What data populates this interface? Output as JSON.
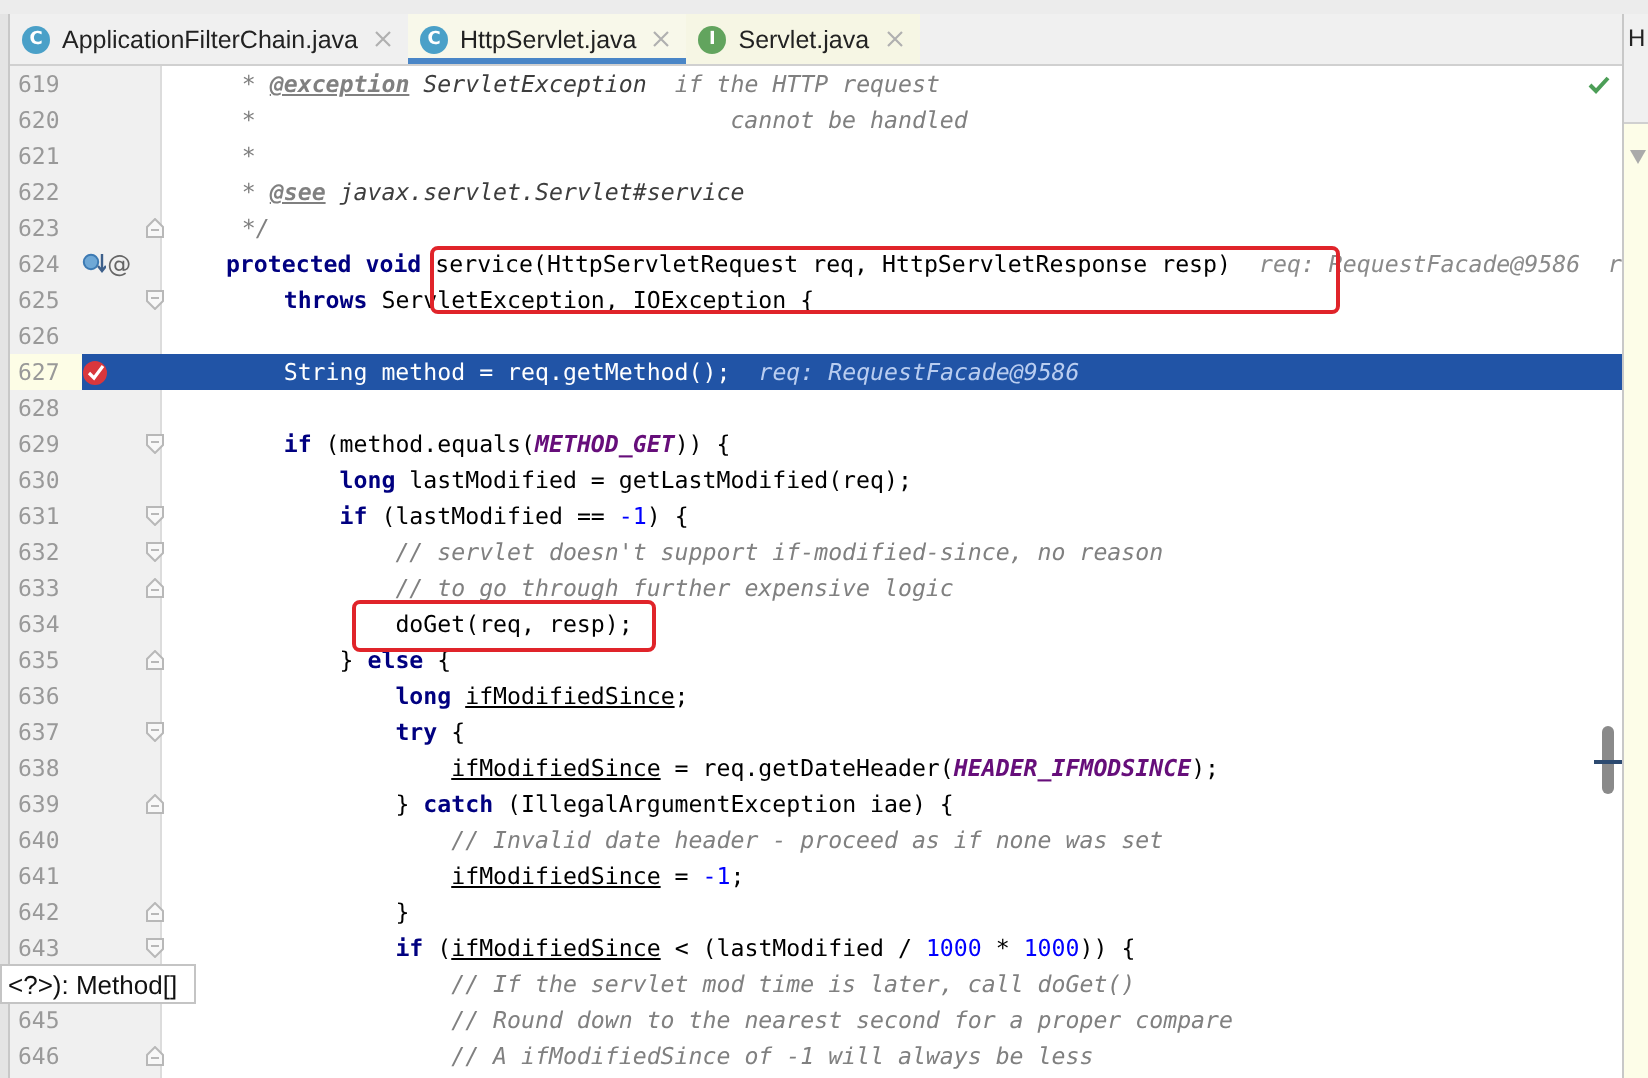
{
  "tabs": [
    {
      "label": "ApplicationFilterChain.java",
      "badge": "C",
      "selected": false,
      "library": false
    },
    {
      "label": "HttpServlet.java",
      "badge": "C",
      "selected": true,
      "library": true
    },
    {
      "label": "Servlet.java",
      "badge": "I",
      "selected": false,
      "library": true
    }
  ],
  "side_panel": {
    "title": "H"
  },
  "lines": [
    {
      "number": "619",
      "tokens": [
        {
          "text": "     * ",
          "kind": "comment"
        },
        {
          "text": "@exception",
          "kind": "doctag"
        },
        {
          "text": " ServletException",
          "kind": "docref"
        },
        {
          "text": "  if the HTTP request",
          "kind": "comment"
        }
      ]
    },
    {
      "number": "620",
      "tokens": [
        {
          "text": "     *                                  cannot be handled",
          "kind": "comment"
        }
      ]
    },
    {
      "number": "621",
      "tokens": [
        {
          "text": "     *",
          "kind": "comment"
        }
      ]
    },
    {
      "number": "622",
      "tokens": [
        {
          "text": "     * ",
          "kind": "comment"
        },
        {
          "text": "@see",
          "kind": "doctag"
        },
        {
          "text": " javax.servlet.Servlet#service",
          "kind": "docref"
        }
      ]
    },
    {
      "number": "623",
      "fold": {
        "kind": "end"
      },
      "tokens": [
        {
          "text": "     */",
          "kind": "comment"
        }
      ]
    },
    {
      "number": "624",
      "marker": {
        "kind": "overriding",
        "symbol": "@"
      },
      "tokens": [
        {
          "text": "    protected void ",
          "kind": "kw"
        },
        {
          "text": "service(HttpServletRequest req, HttpServletResponse resp)",
          "kind": "plain"
        }
      ],
      "hint": "req: RequestFacade@9586  r"
    },
    {
      "number": "625",
      "fold": {
        "kind": "start"
      },
      "tokens": [
        {
          "text": "        throws ",
          "kind": "kw"
        },
        {
          "text": "ServletException, IOException {",
          "kind": "plain"
        }
      ]
    },
    {
      "number": "626"
    },
    {
      "number": "627",
      "selected": true,
      "marker": {
        "kind": "breakpoint"
      },
      "tokens": [
        {
          "text": "        String method = req.getMethod();",
          "kind": "plain"
        }
      ],
      "hint": "req: RequestFacade@9586"
    },
    {
      "number": "628"
    },
    {
      "number": "629",
      "fold": {
        "kind": "start"
      },
      "tokens": [
        {
          "text": "        if ",
          "kind": "kw"
        },
        {
          "text": "(method.equals(",
          "kind": "plain"
        },
        {
          "text": "METHOD_GET",
          "kind": "const"
        },
        {
          "text": ")) {",
          "kind": "plain"
        }
      ]
    },
    {
      "number": "630",
      "tokens": [
        {
          "text": "            long ",
          "kind": "kw"
        },
        {
          "text": "lastModified = getLastModified(req);",
          "kind": "plain"
        }
      ]
    },
    {
      "number": "631",
      "fold": {
        "kind": "start"
      },
      "tokens": [
        {
          "text": "            if ",
          "kind": "kw"
        },
        {
          "text": "(lastModified == ",
          "kind": "plain"
        },
        {
          "text": "-1",
          "kind": "num"
        },
        {
          "text": ") {",
          "kind": "plain"
        }
      ]
    },
    {
      "number": "632",
      "fold": {
        "kind": "start"
      },
      "tokens": [
        {
          "text": "                // servlet doesn't support if-modified-since, no reason",
          "kind": "comment"
        }
      ]
    },
    {
      "number": "633",
      "fold": {
        "kind": "end"
      },
      "tokens": [
        {
          "text": "                // to go through further expensive logic",
          "kind": "comment"
        }
      ]
    },
    {
      "number": "634",
      "tokens": [
        {
          "text": "                doGet(req, resp);",
          "kind": "plain"
        }
      ]
    },
    {
      "number": "635",
      "fold": {
        "kind": "end"
      },
      "tokens": [
        {
          "text": "            } ",
          "kind": "plain"
        },
        {
          "text": "else ",
          "kind": "kw"
        },
        {
          "text": "{",
          "kind": "plain"
        }
      ]
    },
    {
      "number": "636",
      "tokens": [
        {
          "text": "                long ",
          "kind": "kw"
        },
        {
          "text": "ifModifiedSince",
          "kind": "var"
        },
        {
          "text": ";",
          "kind": "plain"
        }
      ]
    },
    {
      "number": "637",
      "fold": {
        "kind": "start"
      },
      "tokens": [
        {
          "text": "                try ",
          "kind": "kw"
        },
        {
          "text": "{",
          "kind": "plain"
        }
      ]
    },
    {
      "number": "638",
      "tokens": [
        {
          "text": "                    ifModifiedSince",
          "kind": "var"
        },
        {
          "text": " = req.getDateHeader(",
          "kind": "plain"
        },
        {
          "text": "HEADER_IFMODSINCE",
          "kind": "const"
        },
        {
          "text": ");",
          "kind": "plain"
        }
      ]
    },
    {
      "number": "639",
      "fold": {
        "kind": "end"
      },
      "tokens": [
        {
          "text": "                } ",
          "kind": "plain"
        },
        {
          "text": "catch ",
          "kind": "kw"
        },
        {
          "text": "(IllegalArgumentException iae) {",
          "kind": "plain"
        }
      ]
    },
    {
      "number": "640",
      "tokens": [
        {
          "text": "                    // Invalid date header - proceed as if none was set",
          "kind": "comment"
        }
      ]
    },
    {
      "number": "641",
      "tokens": [
        {
          "text": "                    ifModifiedSince",
          "kind": "var"
        },
        {
          "text": " = ",
          "kind": "plain"
        },
        {
          "text": "-1",
          "kind": "num"
        },
        {
          "text": ";",
          "kind": "plain"
        }
      ]
    },
    {
      "number": "642",
      "fold": {
        "kind": "end"
      },
      "tokens": [
        {
          "text": "                }",
          "kind": "plain"
        }
      ]
    },
    {
      "number": "643",
      "fold": {
        "kind": "start"
      },
      "tokens": [
        {
          "text": "                if ",
          "kind": "kw"
        },
        {
          "text": "(",
          "kind": "plain"
        },
        {
          "text": "ifModifiedSince",
          "kind": "var"
        },
        {
          "text": " < (lastModified / ",
          "kind": "plain"
        },
        {
          "text": "1000",
          "kind": "num"
        },
        {
          "text": " * ",
          "kind": "plain"
        },
        {
          "text": "1000",
          "kind": "num"
        },
        {
          "text": ")) {",
          "kind": "plain"
        }
      ]
    },
    {
      "tokens": [
        {
          "text": "                    // If the servlet mod time is later, call doGet()",
          "kind": "comment"
        }
      ]
    },
    {
      "number": "645",
      "tokens": [
        {
          "text": "                    // Round down to the nearest second for a proper compare",
          "kind": "comment"
        }
      ]
    },
    {
      "number": "646",
      "fold": {
        "kind": "end"
      },
      "tokens": [
        {
          "text": "                    // A ifModifiedSince of -1 will always be less",
          "kind": "comment"
        }
      ]
    }
  ],
  "annotations": [
    {
      "kind": "red-box"
    },
    {
      "kind": "red-box"
    }
  ],
  "popup": {
    "text": "<?>): Method[]"
  }
}
